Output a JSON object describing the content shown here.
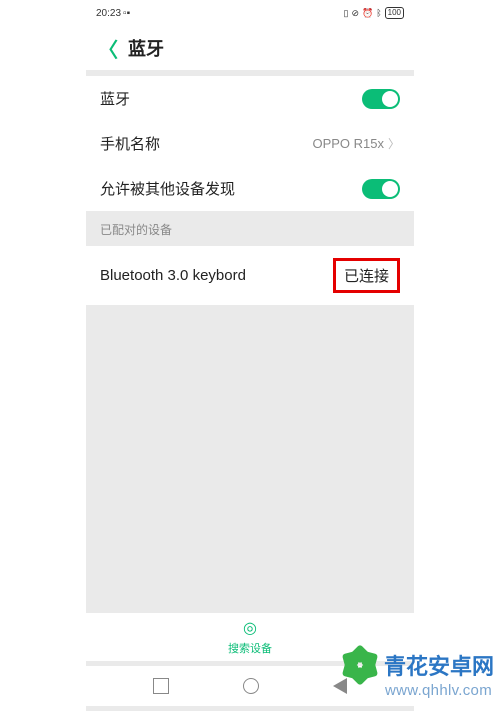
{
  "status": {
    "time": "20:23",
    "battery": "100"
  },
  "header": {
    "title": "蓝牙"
  },
  "settings": {
    "bluetooth_label": "蓝牙",
    "phone_name_label": "手机名称",
    "phone_name_value": "OPPO R15x",
    "discoverable_label": "允许被其他设备发现"
  },
  "paired": {
    "section_title": "已配对的设备",
    "device_name": "Bluetooth 3.0 keybord",
    "status": "已连接"
  },
  "search": {
    "label": "搜索设备"
  },
  "watermark": {
    "brand": "青花安卓网",
    "url": "www.qhhlv.com"
  }
}
